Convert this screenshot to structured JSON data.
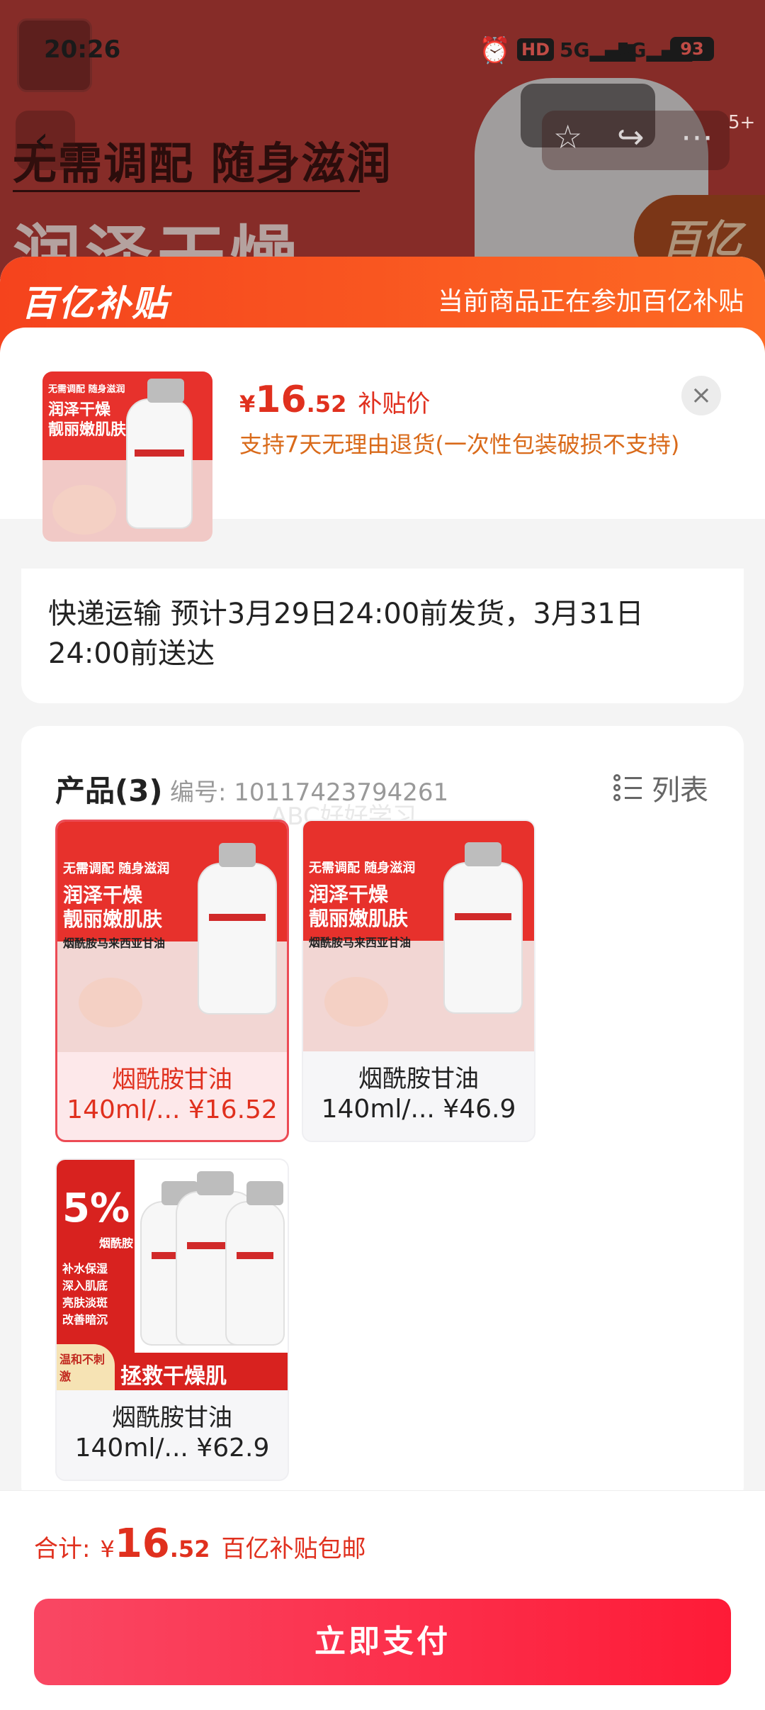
{
  "status_bar": {
    "time": "20:26",
    "network_1": "5G",
    "network_2": "5G",
    "battery": "93"
  },
  "background": {
    "banner_line1": "无需调配 随身滋润",
    "banner_line2": "润泽干燥",
    "badge": "百亿",
    "tab_count": "5+"
  },
  "promo": {
    "brand": "百亿补贴",
    "note": "当前商品正在参加百亿补贴"
  },
  "header": {
    "price_yen": "¥",
    "price_int": "16",
    "price_dec": ".52",
    "price_label": "补贴价",
    "return_policy": "支持7天无理由退货(一次性包装破损不支持)",
    "close_label": "×"
  },
  "shipping": {
    "text": "快递运输 预计3月29日24:00前发货，3月31日24:00前送达"
  },
  "products": {
    "title": "产品(3)",
    "code": "编号: 10117423794261",
    "list_toggle": "列表",
    "watermark": "ABC好好学习",
    "items": [
      {
        "name": "烟酰胺甘油",
        "spec": "140ml/... ¥16.52",
        "selected": true
      },
      {
        "name": "烟酰胺甘油",
        "spec": "140ml/... ¥46.9",
        "selected": false
      },
      {
        "name": "烟酰胺甘油",
        "spec": "140ml/... ¥62.9",
        "selected": false
      }
    ],
    "art_text": {
      "line1": "无需调配 随身滋润",
      "line2": "润泽干燥",
      "line3": "靓丽嫩肌肤",
      "line4": "烟酰胺马来西亚甘油",
      "pct": "5%",
      "pct_sub": "烟酰胺",
      "bullets": [
        "补水保湿",
        "深入肌底",
        "亮肤淡斑",
        "改善暗沉"
      ],
      "mild": "温和不刺激",
      "rescue": "拯救干燥肌"
    }
  },
  "footer": {
    "total_label": "合计:",
    "total_yen": "¥",
    "total_int": "16",
    "total_dec": ".52",
    "total_note": "百亿补贴包邮",
    "pay_button": "立即支付"
  },
  "colors": {
    "accent": "#e0301e",
    "promo_start": "#f5431d",
    "promo_end": "#fd6a24",
    "pay_button": "#fe1b37"
  }
}
